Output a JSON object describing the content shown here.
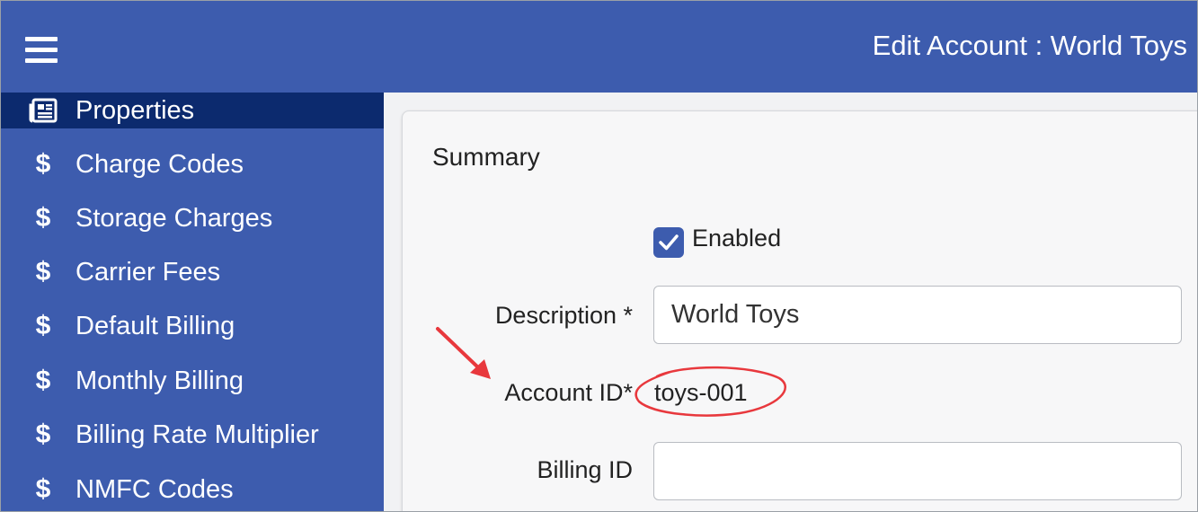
{
  "header": {
    "title": "Edit Account : World Toys",
    "menu_icon": "hamburger-menu-icon",
    "background_color": "#3d5cae"
  },
  "sidebar": {
    "active_color": "#0c2a6e",
    "items": [
      {
        "label": "Properties",
        "icon": "properties-icon",
        "active": true
      },
      {
        "label": "Charge Codes",
        "icon": "dollar-icon"
      },
      {
        "label": "Storage Charges",
        "icon": "dollar-icon"
      },
      {
        "label": "Carrier Fees",
        "icon": "dollar-icon"
      },
      {
        "label": "Default Billing",
        "icon": "dollar-icon"
      },
      {
        "label": "Monthly Billing",
        "icon": "dollar-icon"
      },
      {
        "label": "Billing Rate Multiplier",
        "icon": "dollar-icon"
      },
      {
        "label": "NMFC Codes",
        "icon": "dollar-icon"
      }
    ]
  },
  "icons": {
    "dollar": "$"
  },
  "summary": {
    "title": "Summary",
    "enabled": {
      "label": "Enabled",
      "checked": true
    },
    "description": {
      "label": "Description *",
      "value": "World Toys"
    },
    "account_id": {
      "label": "Account ID*",
      "value": "toys-001"
    },
    "billing_id": {
      "label": "Billing ID",
      "value": ""
    }
  },
  "annotation": {
    "color": "#e8383d",
    "shapes": [
      "arrow",
      "ellipse"
    ]
  }
}
